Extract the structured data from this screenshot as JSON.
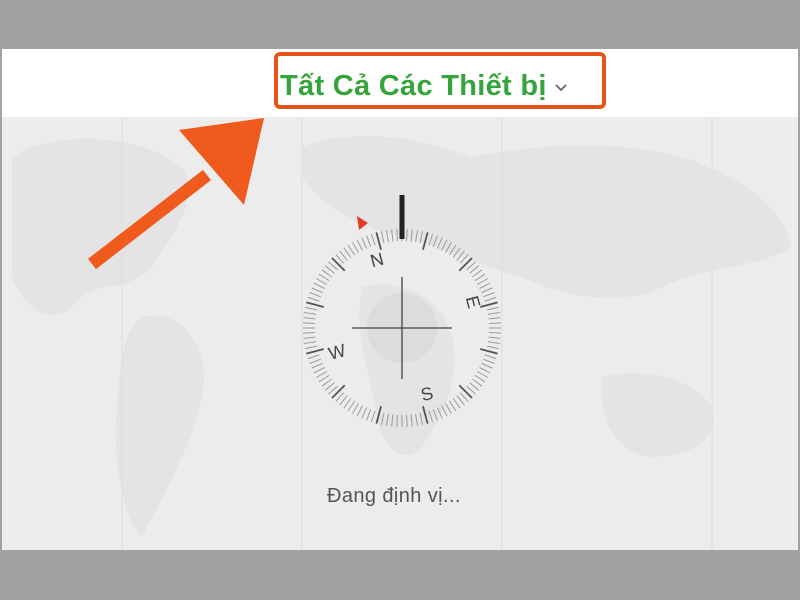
{
  "header": {
    "device_selector_label": "Tất Cả Các Thiết bị",
    "chevron_icon": "chevron-down-icon"
  },
  "compass": {
    "labels": {
      "north": "N",
      "east": "E",
      "south": "S",
      "west": "W"
    },
    "icon": "compass-icon"
  },
  "status": {
    "text": "Đang định vị..."
  },
  "colors": {
    "label_green": "#34a43b",
    "annotation_orange": "#e8531a",
    "map_gray": "#ececec",
    "heading_marker_red": "#e23b2a"
  }
}
